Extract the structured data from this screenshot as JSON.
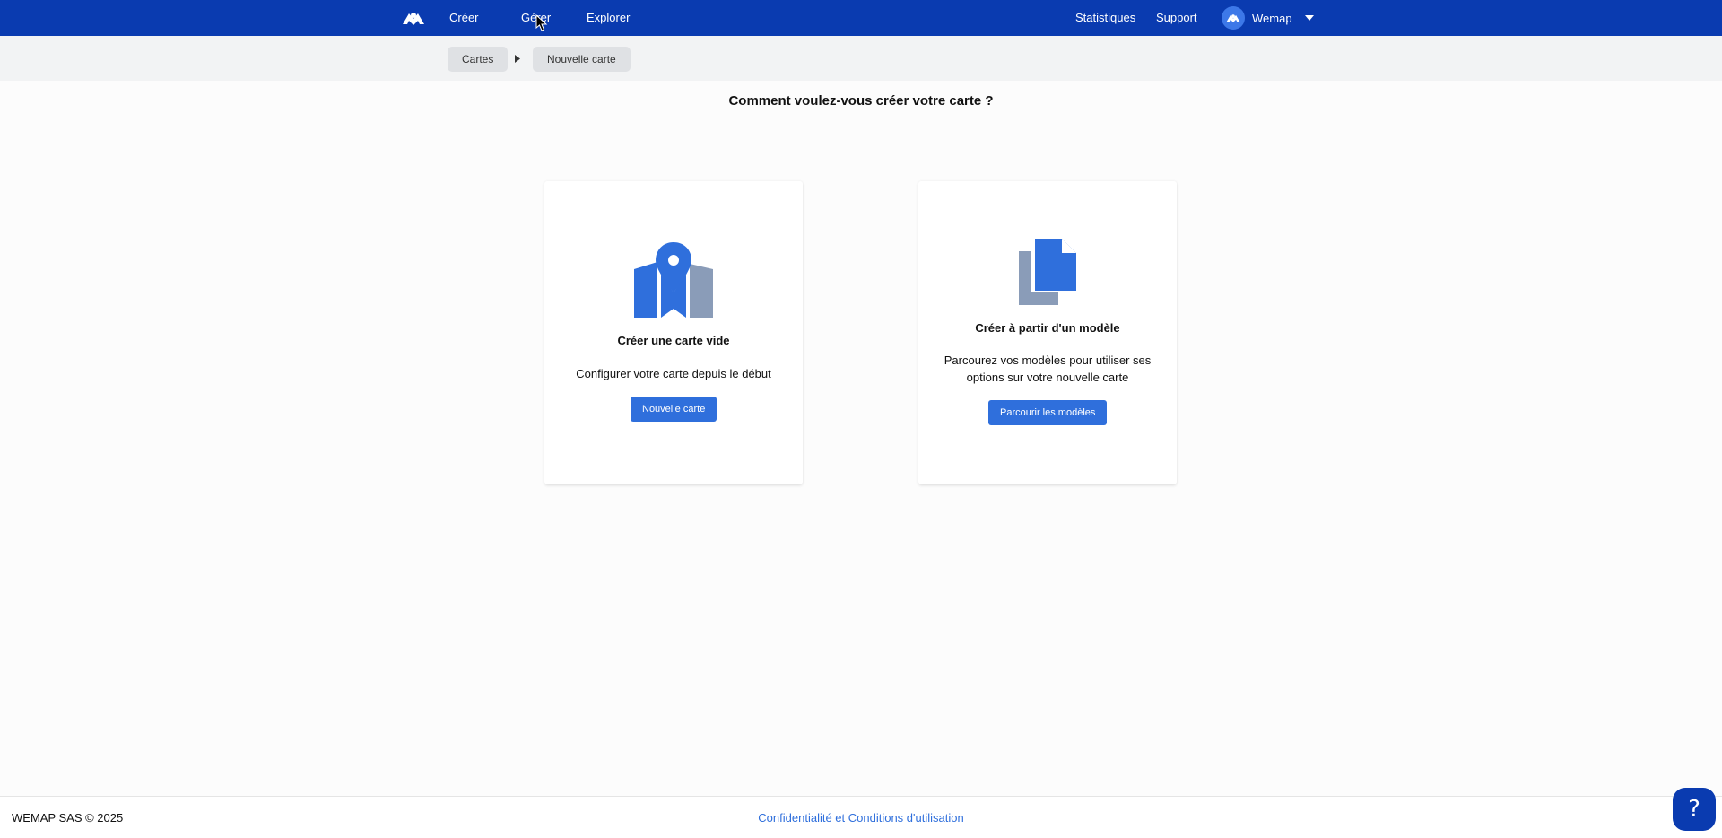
{
  "topnav": {
    "logo_icon": "wemap-logo-icon",
    "items": [
      {
        "label": "Créer"
      },
      {
        "label": "Gérer"
      },
      {
        "label": "Explorer"
      }
    ],
    "right_items": [
      {
        "label": "Statistiques"
      },
      {
        "label": "Support"
      }
    ],
    "user": {
      "name": "Wemap",
      "avatar_icon": "wemap-avatar-icon",
      "caret_icon": "caret-down-icon"
    },
    "background_color": "#0a3bb0"
  },
  "breadcrumb": {
    "items": [
      {
        "label": "Cartes"
      },
      {
        "label": "Nouvelle carte"
      }
    ],
    "separator_icon": "caret-right-icon"
  },
  "main": {
    "question": "Comment voulez-vous créer votre carte ?",
    "cards": [
      {
        "icon": "map-pin-icon",
        "title": "Créer une carte vide",
        "description": "Configurer votre carte depuis le début",
        "button_label": "Nouvelle carte"
      },
      {
        "icon": "copy-documents-icon",
        "title": "Créer à partir d'un modèle",
        "description": "Parcourez vos modèles pour utiliser ses options sur votre nouvelle carte",
        "button_label": "Parcourir les modèles"
      }
    ],
    "accent_color": "#2f6fdc"
  },
  "footer": {
    "copyright": "WEMAP SAS © 2025",
    "link_label": "Confidentialité et Conditions d'utilisation",
    "help_label": "?"
  }
}
